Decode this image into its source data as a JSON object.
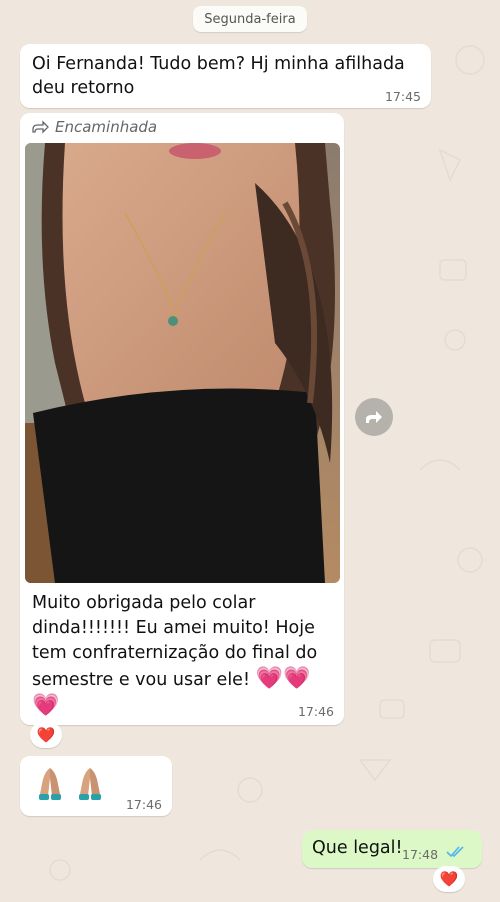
{
  "date_chip": "Segunda-feira",
  "messages": {
    "m1": {
      "text": "Oi Fernanda! Tudo bem? Hj minha afilhada deu retorno",
      "time": "17:45"
    },
    "m2": {
      "forwarded_label": "Encaminhada",
      "caption": "Muito obrigada pelo colar dinda!!!!!!! Eu amei muito! Hoje tem confraternização do final do semestre e vou usar ele!",
      "caption_emoji": "💗💗💗",
      "time": "17:46",
      "reaction": "❤️"
    },
    "m3": {
      "time": "17:46",
      "emoji_icons": [
        "folded-hands-icon",
        "folded-hands-icon"
      ]
    },
    "m4": {
      "text": "Que legal!",
      "time": "17:48",
      "status": "read",
      "reaction": "❤️"
    }
  },
  "colors": {
    "background": "#efe7dd",
    "incoming_bubble": "#ffffff",
    "outgoing_bubble": "#dcf8c6",
    "read_ticks": "#4fb6ec",
    "heart": "#e0202a",
    "pink_heart": "#f0508e"
  }
}
